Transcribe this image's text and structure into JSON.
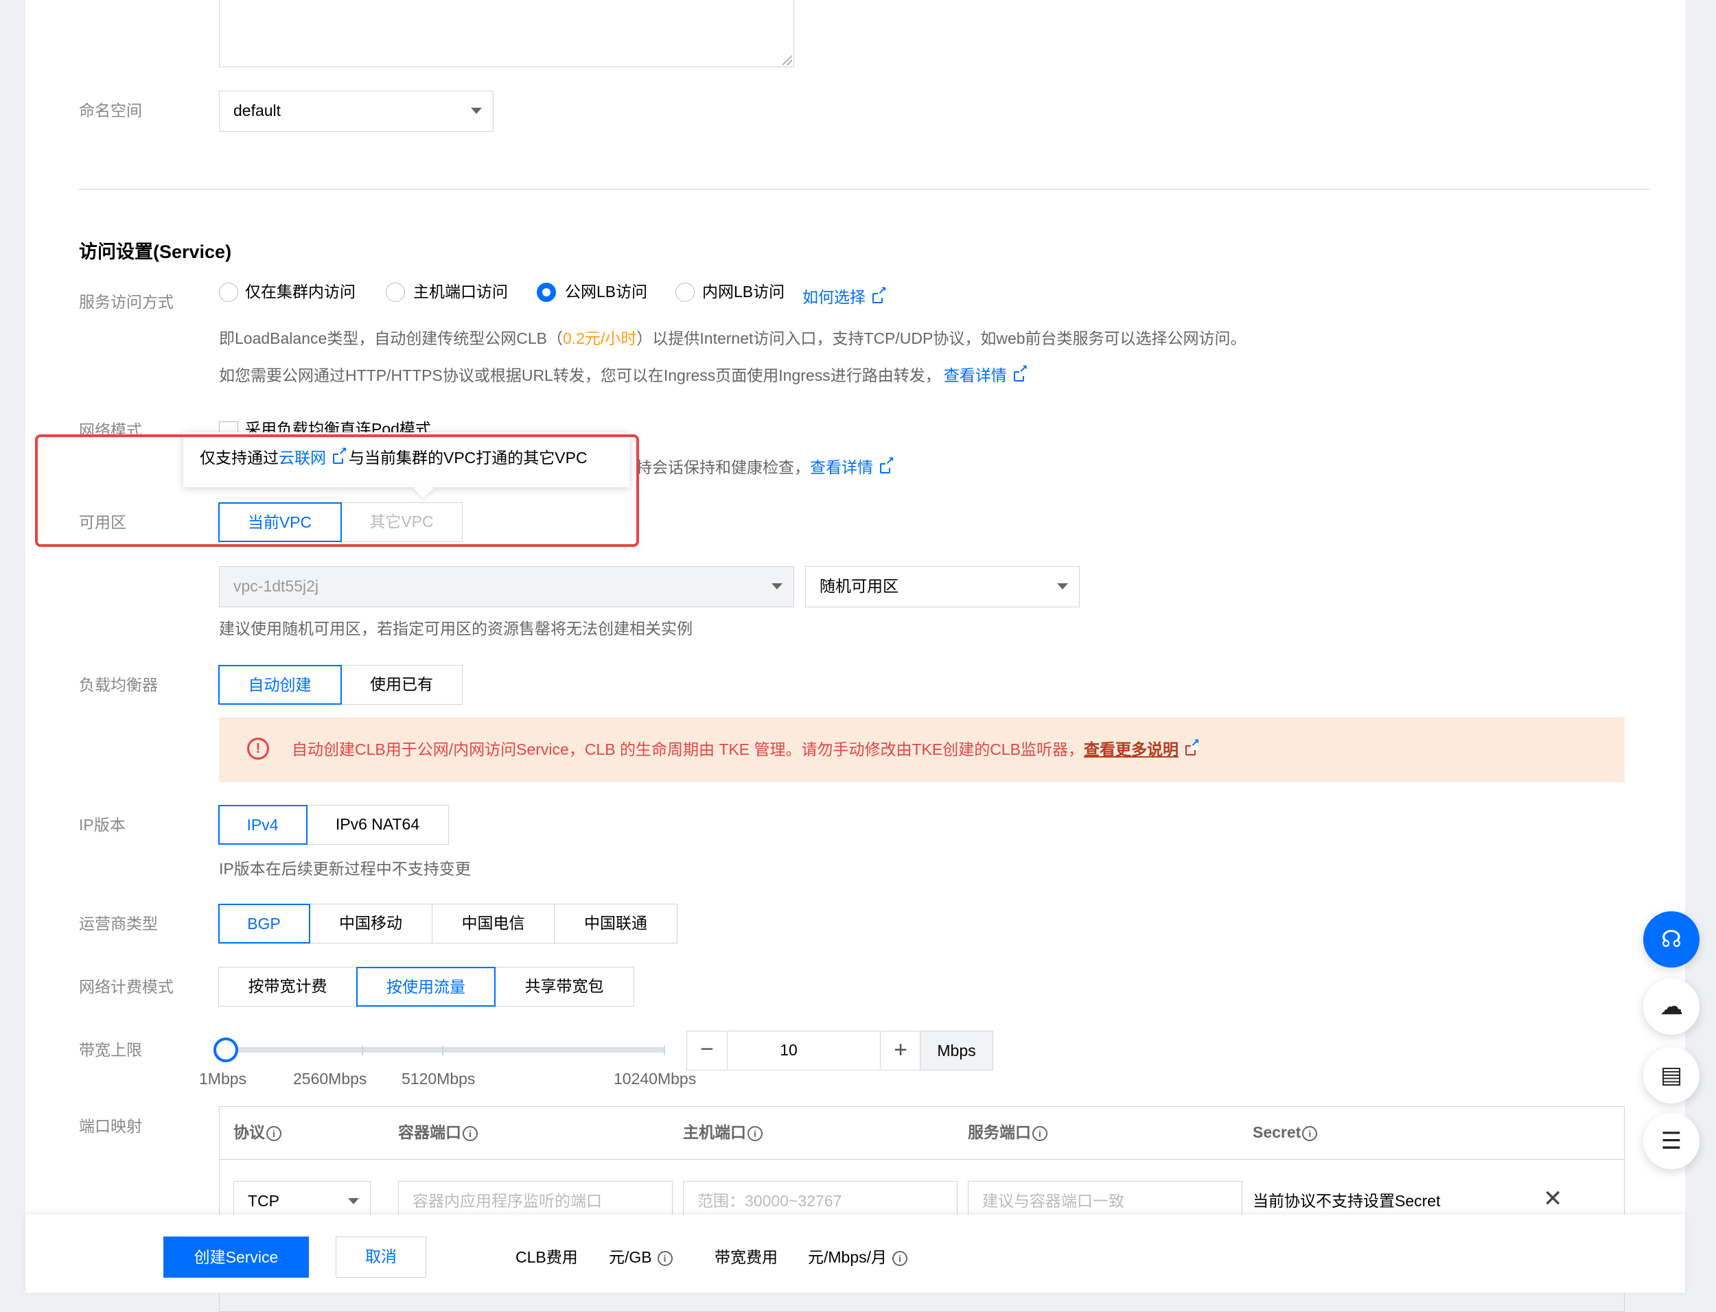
{
  "namespace": {
    "label": "命名空间",
    "value": "default"
  },
  "service": {
    "section_title": "访问设置(Service)",
    "access_label": "服务访问方式",
    "options": [
      "仅在集群内访问",
      "主机端口访问",
      "公网LB访问",
      "内网LB访问"
    ],
    "selected_option": "公网LB访问",
    "how_to_choose": "如何选择",
    "desc1_a": "即LoadBalance类型，自动创建传统型公网CLB（",
    "desc1_price": "0.2元/小时",
    "desc1_b": "）以提供Internet访问入口，支持TCP/UDP协议，如web前台类服务可以选择公网访问。",
    "desc2": "如您需要公网通过HTTP/HTTPS协议或根据URL转发，您可以在Ingress页面使用Ingress进行路由转发，",
    "desc2_link": "查看详情"
  },
  "network_mode": {
    "label": "网络模式",
    "checkbox_label": "采用负载均衡直连Pod模式",
    "hint_tail": "持会话保持和健康检查，",
    "hint_link": "查看详情"
  },
  "tooltip": {
    "prefix": "仅支持通过",
    "link": "云联网",
    "suffix": "与当前集群的VPC打通的其它VPC"
  },
  "availability": {
    "label": "可用区",
    "vpc_tabs": [
      "当前VPC",
      "其它VPC"
    ],
    "vpc_value": "vpc-1dt55j2j",
    "zone_value": "随机可用区",
    "hint": "建议使用随机可用区，若指定可用区的资源售罄将无法创建相关实例"
  },
  "lb": {
    "label": "负载均衡器",
    "tabs": [
      "自动创建",
      "使用已有"
    ],
    "warning": "自动创建CLB用于公网/内网访问Service，CLB 的生命周期由 TKE 管理。请勿手动修改由TKE创建的CLB监听器，",
    "warning_link": "查看更多说明"
  },
  "ip_version": {
    "label": "IP版本",
    "tabs": [
      "IPv4",
      "IPv6 NAT64"
    ],
    "hint": "IP版本在后续更新过程中不支持变更"
  },
  "isp": {
    "label": "运营商类型",
    "tabs": [
      "BGP",
      "中国移动",
      "中国电信",
      "中国联通"
    ]
  },
  "billing": {
    "label": "网络计费模式",
    "tabs": [
      "按带宽计费",
      "按使用流量",
      "共享带宽包"
    ]
  },
  "bandwidth": {
    "label": "带宽上限",
    "ticks": [
      "1Mbps",
      "2560Mbps",
      "5120Mbps",
      "10240Mbps"
    ],
    "value": "10",
    "unit": "Mbps",
    "slider_fraction": 0.001
  },
  "ports": {
    "label": "端口映射",
    "headers": [
      "协议",
      "容器端口",
      "主机端口",
      "服务端口",
      "Secret"
    ],
    "protocol": "TCP",
    "container_placeholder": "容器内应用程序监听的端口",
    "host_placeholder": "范围：30000~32767",
    "service_placeholder": "建议与容器端口一致",
    "secret_note": "当前协议不支持设置Secret"
  },
  "footer": {
    "create": "创建Service",
    "cancel": "取消",
    "clb_fee": "CLB费用",
    "unit_gb": "元/GB",
    "bw_fee": "带宽费用",
    "unit_mbps": "元/Mbps/月"
  },
  "colors": {
    "accent": "#006eff",
    "warning_bg": "#fcebdd",
    "warning_text": "#e54545",
    "price": "#ff9c19",
    "highlight": "#e54545"
  }
}
